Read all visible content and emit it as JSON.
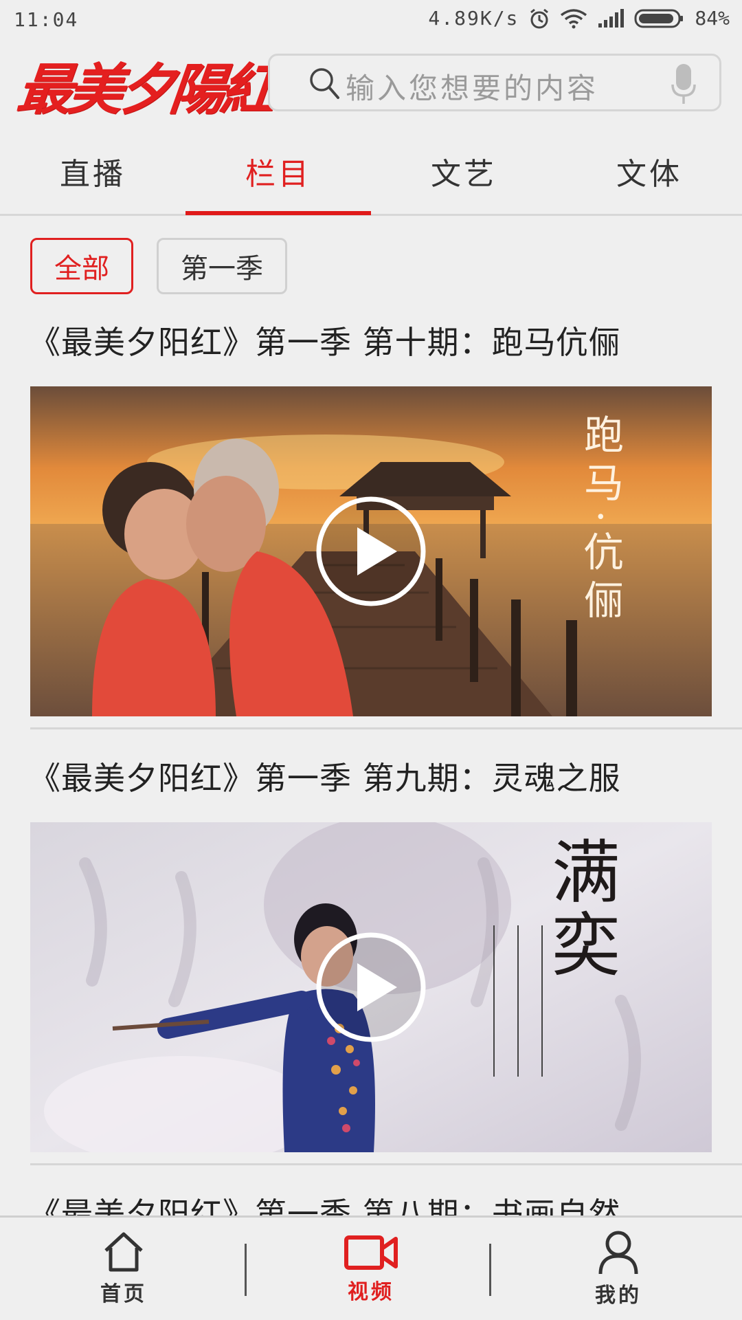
{
  "status_bar": {
    "time": "11:04",
    "net_speed": "4.89K/s",
    "battery": "84%",
    "icons": [
      "alarm-icon",
      "wifi-icon",
      "signal-icon",
      "battery-icon"
    ]
  },
  "header": {
    "brand": "最美夕陽紅",
    "search_placeholder": "输入您想要的内容",
    "icons": [
      "search-icon",
      "mic-icon"
    ]
  },
  "tabs": [
    {
      "label": "直播",
      "active": false
    },
    {
      "label": "栏目",
      "active": true
    },
    {
      "label": "文艺",
      "active": false
    },
    {
      "label": "文体",
      "active": false
    }
  ],
  "filters": [
    {
      "label": "全部",
      "active": true
    },
    {
      "label": "第一季",
      "active": false
    }
  ],
  "episodes": [
    {
      "title": "《最美夕阳红》第一季 第十期：跑马伉俪",
      "thumb_text": "跑马·伉俪"
    },
    {
      "title": "《最美夕阳红》第一季 第九期：灵魂之服",
      "thumb_text": "满奕"
    },
    {
      "title": "《最美夕阳红》第一季 第八期：书画自然"
    }
  ],
  "bottom_nav": [
    {
      "label": "首页",
      "icon": "home-icon",
      "active": false
    },
    {
      "label": "视频",
      "icon": "video-camera-icon",
      "active": true
    },
    {
      "label": "我的",
      "icon": "user-icon",
      "active": false
    }
  ],
  "colors": {
    "accent": "#e02020",
    "background": "#efefef"
  }
}
